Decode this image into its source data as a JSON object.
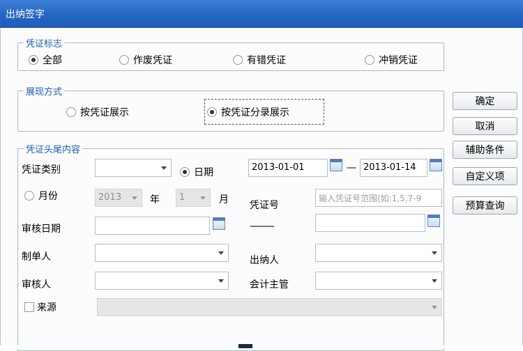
{
  "window": {
    "title": "出纳签字"
  },
  "voucher_flag": {
    "legend": "凭证标志",
    "options": [
      {
        "label": "全部",
        "selected": true
      },
      {
        "label": "作废凭证",
        "selected": false
      },
      {
        "label": "有错凭证",
        "selected": false
      },
      {
        "label": "冲销凭证",
        "selected": false
      }
    ]
  },
  "display_mode": {
    "legend": "展现方式",
    "options": [
      {
        "label": "按凭证展示",
        "selected": false
      },
      {
        "label": "按凭证分录展示",
        "selected": true
      }
    ]
  },
  "header_content": {
    "legend": "凭证头尾内容",
    "voucher_type_label": "凭证类别",
    "voucher_type_value": "",
    "date_radio_label": "日期",
    "date_from": "2013-01-01",
    "date_to": "2013-01-14",
    "range_separator": "—",
    "month_radio_label": "月份",
    "year_value": "2013",
    "year_unit": "年",
    "month_value": "1",
    "month_unit": "月",
    "voucher_no_label": "凭证号",
    "voucher_no_placeholder": "输入凭证号范围(如:1,5,7-9",
    "audit_date_label": "审核日期",
    "audit_date_from": "",
    "audit_date_to": "",
    "maker_label": "制单人",
    "maker_value": "",
    "cashier_label": "出纳人",
    "cashier_value": "",
    "auditor_label": "审核人",
    "auditor_value": "",
    "accounting_supervisor_label": "会计主管",
    "accounting_supervisor_value": "",
    "source_checkbox_label": "来源",
    "source_checked": false,
    "source_value": ""
  },
  "buttons": {
    "ok": "确定",
    "cancel": "取消",
    "aux_conditions": "辅助条件",
    "custom_items": "自定义项",
    "budget_query": "预算查询"
  }
}
